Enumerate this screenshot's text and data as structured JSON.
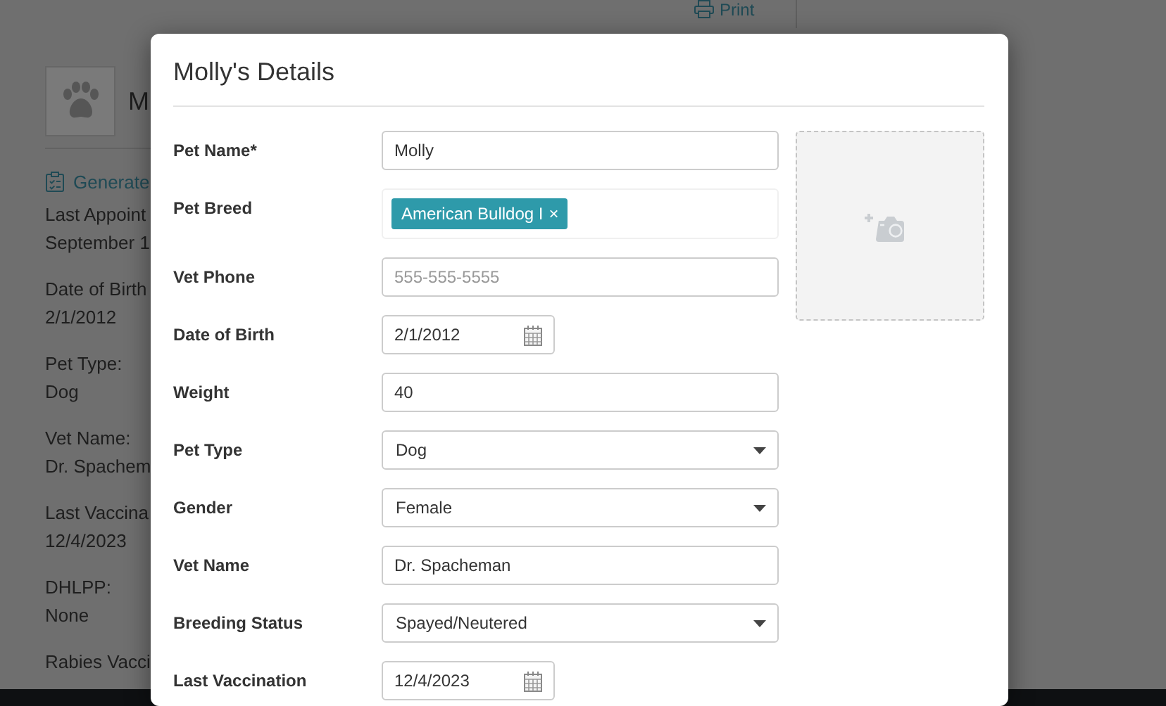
{
  "background_page": {
    "print_link": "Print",
    "pet_initial": "M",
    "generate_link": "Generate",
    "details": [
      {
        "label": "Last Appoint",
        "value": "September 1"
      },
      {
        "label": "Date of Birth",
        "value": "2/1/2012"
      },
      {
        "label": "Pet Type:",
        "value": "Dog"
      },
      {
        "label": "Vet Name:",
        "value": "Dr. Spachem"
      },
      {
        "label": "Last Vaccina",
        "value": "12/4/2023"
      },
      {
        "label": "DHLPP:",
        "value": "None"
      },
      {
        "label": "Rabies Vacci"
      }
    ]
  },
  "modal": {
    "title": "Molly's Details",
    "fields": [
      {
        "kind": "text",
        "label": "Pet Name*",
        "value": "Molly"
      },
      {
        "kind": "tags",
        "label": "Pet Breed",
        "tags": [
          "American Bulldog I"
        ],
        "remove": "×"
      },
      {
        "kind": "text",
        "label": "Vet Phone",
        "placeholder": "555-555-5555"
      },
      {
        "kind": "date",
        "label": "Date of Birth",
        "value": "2/1/2012"
      },
      {
        "kind": "text",
        "label": "Weight",
        "value": "40"
      },
      {
        "kind": "select",
        "label": "Pet Type",
        "value": "Dog"
      },
      {
        "kind": "select",
        "label": "Gender",
        "value": "Female"
      },
      {
        "kind": "text",
        "label": "Vet Name",
        "value": "Dr. Spacheman"
      },
      {
        "kind": "select",
        "label": "Breeding Status",
        "value": "Spayed/Neutered"
      },
      {
        "kind": "date",
        "label": "Last Vaccination",
        "value": "12/4/2023"
      }
    ]
  }
}
